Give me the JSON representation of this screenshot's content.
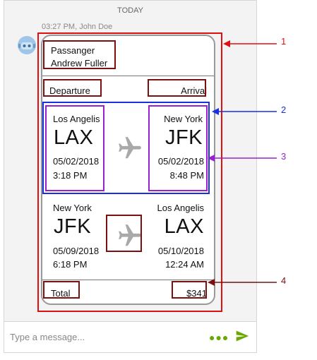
{
  "chat": {
    "date_separator": "TODAY",
    "message_meta": "03:27 PM, John Doe"
  },
  "ticket": {
    "passenger_label": "Passanger",
    "passenger_name": "Andrew Fuller",
    "departure_label": "Departure",
    "arrival_label": "Arrival",
    "flights": [
      {
        "from_city": "Los Angelis",
        "from_code": "LAX",
        "from_date": "05/02/2018",
        "from_time": "3:18 PM",
        "to_city": "New York",
        "to_code": "JFK",
        "to_date": "05/02/2018",
        "to_time": "8:48 PM"
      },
      {
        "from_city": "New York",
        "from_code": "JFK",
        "from_date": "05/09/2018",
        "from_time": "6:18 PM",
        "to_city": "Los Angelis",
        "to_code": "LAX",
        "to_date": "05/10/2018",
        "to_time": "12:24 AM"
      }
    ],
    "total_label": "Total",
    "total_value": "$341"
  },
  "callouts": [
    "1",
    "2",
    "3",
    "4"
  ],
  "composer": {
    "placeholder": "Type a message...",
    "more_icon": "more-dots-icon",
    "send_icon": "send-icon"
  },
  "colors": {
    "callout_1": "#e01010",
    "callout_2": "#1a2fe0",
    "callout_3": "#9a1fd0",
    "callout_4": "#7a1010",
    "accent_green": "#6aa800"
  }
}
